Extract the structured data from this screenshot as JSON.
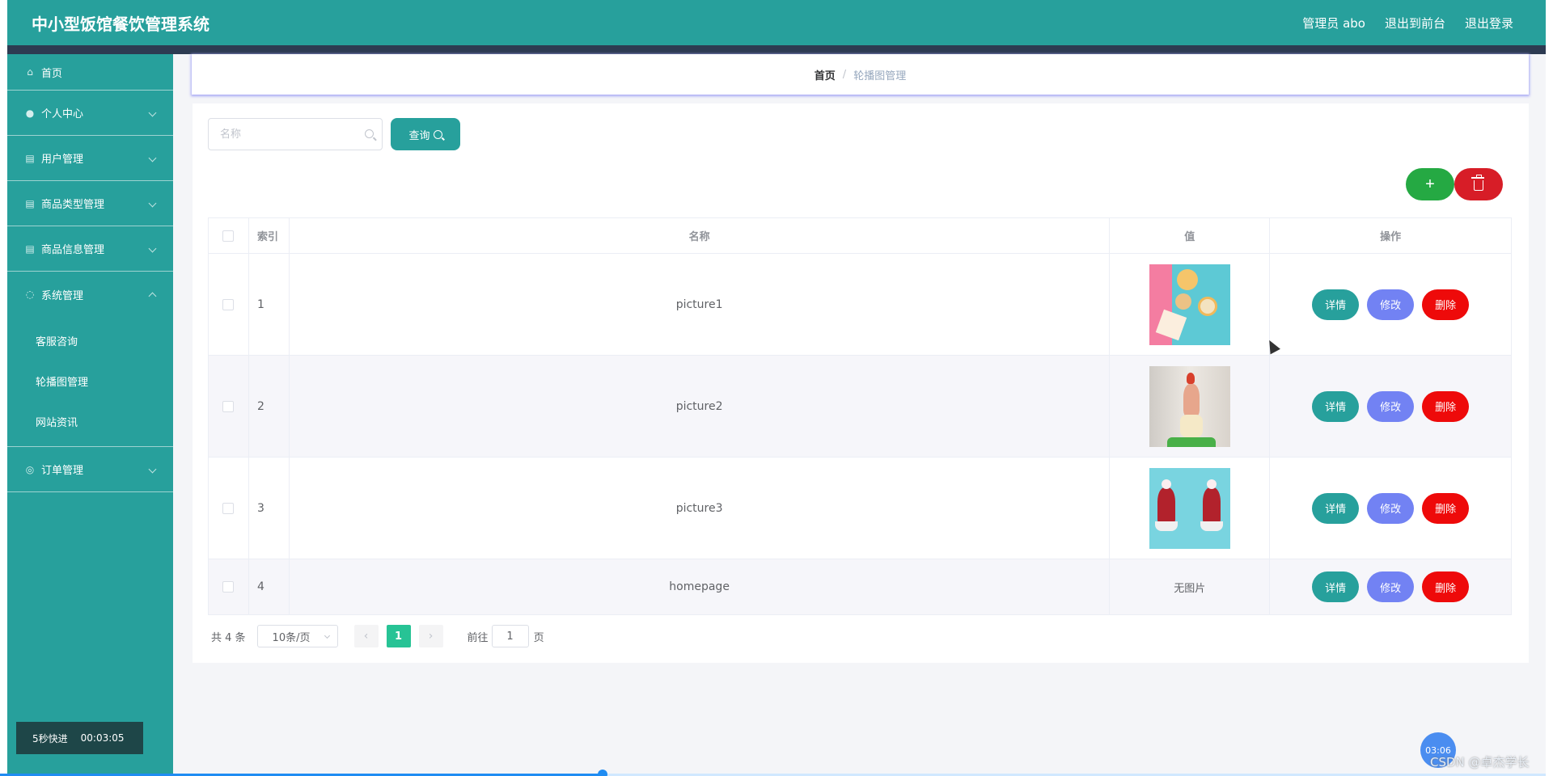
{
  "header": {
    "title": "中小型饭馆餐饮管理系统",
    "admin_label": "管理员 abo",
    "frontend_link": "退出到前台",
    "logout_link": "退出登录"
  },
  "sidebar": {
    "items": [
      {
        "label": "首页",
        "icon": "home-icon"
      },
      {
        "label": "个人中心",
        "icon": "user-icon"
      },
      {
        "label": "用户管理",
        "icon": "clipboard-icon"
      },
      {
        "label": "商品类型管理",
        "icon": "clipboard-icon"
      },
      {
        "label": "商品信息管理",
        "icon": "clipboard-icon"
      },
      {
        "label": "系统管理",
        "icon": "power-icon"
      },
      {
        "label": "订单管理",
        "icon": "compass-icon"
      }
    ],
    "system_subitems": [
      "客服咨询",
      "轮播图管理",
      "网站资讯"
    ]
  },
  "breadcrumb": {
    "home": "首页",
    "separator": "/",
    "current": "轮播图管理"
  },
  "search": {
    "placeholder": "名称",
    "query_label": "查询"
  },
  "actions": {
    "add_label": "+"
  },
  "table": {
    "headers": {
      "index": "索引",
      "name": "名称",
      "value": "值",
      "operations": "操作"
    },
    "rows": [
      {
        "index": "1",
        "name": "picture1",
        "has_image": true
      },
      {
        "index": "2",
        "name": "picture2",
        "has_image": true
      },
      {
        "index": "3",
        "name": "picture3",
        "has_image": true
      },
      {
        "index": "4",
        "name": "homepage",
        "has_image": false,
        "value_text": "无图片"
      }
    ],
    "op_labels": {
      "detail": "详情",
      "edit": "修改",
      "delete": "删除"
    }
  },
  "pagination": {
    "total": "共 4 条",
    "page_size": "10条/页",
    "current_page": "1",
    "goto_prefix": "前往",
    "goto_value": "1",
    "goto_suffix": "页",
    "prev_icon": "‹",
    "next_icon": "›"
  },
  "player": {
    "skip_label": "5秒快进",
    "elapsed": "00:03:05",
    "bubble_time": "03:06",
    "progress": 0.388
  },
  "watermark": "CSDN @卓杰学长",
  "colors": {
    "primary": "#27a09c",
    "add": "#25a943",
    "bulk_delete": "#d71d27",
    "edit": "#7282f3",
    "delete": "#ee0a0a",
    "page_active": "#27c395"
  }
}
